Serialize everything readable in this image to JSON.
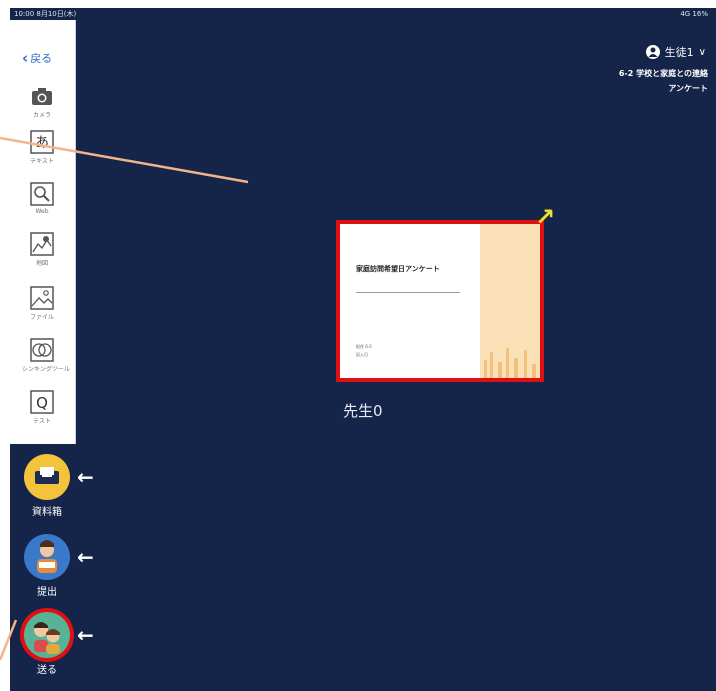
{
  "status_bar": {
    "left": "10:00 8月10日(木)",
    "right": "4G 16%"
  },
  "toolbar": {
    "back_label": "戻る",
    "tools": [
      {
        "label": "カメラ",
        "icon": "camera-icon"
      },
      {
        "label": "テキスト",
        "icon": "text-icon"
      },
      {
        "label": "Web",
        "icon": "web-search-icon"
      },
      {
        "label": "地図",
        "icon": "map-icon"
      },
      {
        "label": "ファイル",
        "icon": "image-file-icon"
      },
      {
        "label": "シンキングツール",
        "icon": "thinking-tool-icon"
      },
      {
        "label": "テスト",
        "icon": "quiz-icon"
      }
    ]
  },
  "side_buttons": [
    {
      "label": "資料箱",
      "icon": "document-box-icon"
    },
    {
      "label": "提出",
      "icon": "submit-icon"
    },
    {
      "label": "送る",
      "icon": "send-icon"
    }
  ],
  "header": {
    "user": "生徒1",
    "lesson_line1": "6-2 学校と家庭との連絡",
    "lesson_line2": "アンケート"
  },
  "card": {
    "title": "家庭訪問希望日アンケート",
    "line1": "担任 6-2",
    "line2": "記入日"
  },
  "teacher_label": "先生0",
  "colors": {
    "background": "#152449",
    "highlight": "#e00f12",
    "annotation": "#f2b48a"
  }
}
